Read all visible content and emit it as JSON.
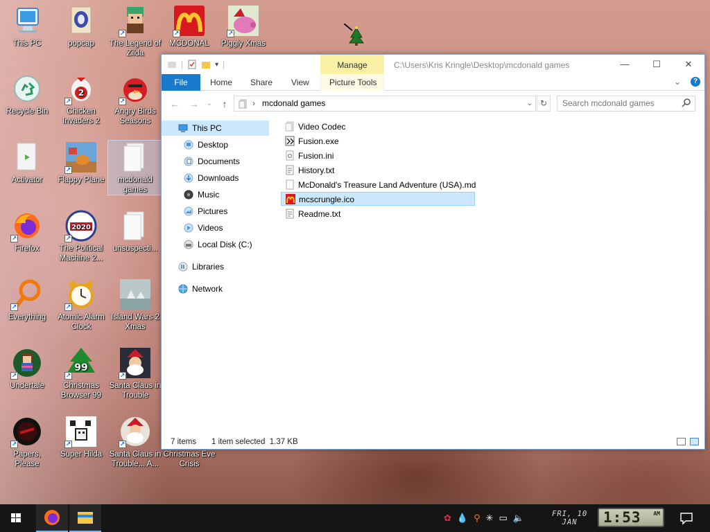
{
  "desktop": {
    "icons": [
      {
        "label": "This PC"
      },
      {
        "label": "popcap"
      },
      {
        "label": "The Legend of Zilda"
      },
      {
        "label": "MCDONAL"
      },
      {
        "label": "Piggly Xmas"
      },
      {
        "label": "Recycle Bin"
      },
      {
        "label": "Chicken Invaders 2"
      },
      {
        "label": "Angry Birds Seasons"
      },
      {
        "label": "Activator"
      },
      {
        "label": "Flappy Plane"
      },
      {
        "label": "mcdonald games"
      },
      {
        "label": "Firefox"
      },
      {
        "label": "The Political Machine 2..."
      },
      {
        "label": "unsuspecti..."
      },
      {
        "label": "Everything"
      },
      {
        "label": "Atomic Alarm Clock"
      },
      {
        "label": "Island Wars 2 Xmas"
      },
      {
        "label": "Undertale"
      },
      {
        "label": "Christmas Browser 99"
      },
      {
        "label": "Santa Claus in Trouble"
      },
      {
        "label": "Papers, Please"
      },
      {
        "label": "Super Hilda"
      },
      {
        "label": "Santa Claus in Trouble... A..."
      },
      {
        "label": "Christmas Eve Crisis"
      }
    ]
  },
  "explorer": {
    "title_path": "C:\\Users\\Kris Kringle\\Desktop\\mcdonald games",
    "contextual_tab_group": "Manage",
    "ribbon_tabs": [
      "File",
      "Home",
      "Share",
      "View",
      "Picture Tools"
    ],
    "address": "mcdonald games",
    "search_placeholder": "Search mcdonald games",
    "nav": [
      {
        "label": "This PC"
      },
      {
        "label": "Desktop"
      },
      {
        "label": "Documents"
      },
      {
        "label": "Downloads"
      },
      {
        "label": "Music"
      },
      {
        "label": "Pictures"
      },
      {
        "label": "Videos"
      },
      {
        "label": "Local Disk (C:)"
      },
      {
        "label": "Libraries"
      },
      {
        "label": "Network"
      }
    ],
    "files": [
      {
        "name": "Video Codec",
        "icon": "folder-icon"
      },
      {
        "name": "Fusion.exe",
        "icon": "exe-icon"
      },
      {
        "name": "Fusion.ini",
        "icon": "settings-file-icon"
      },
      {
        "name": "History.txt",
        "icon": "text-file-icon"
      },
      {
        "name": "McDonald's Treasure Land Adventure (USA).md",
        "icon": "file-icon"
      },
      {
        "name": "mcscrungle.ico",
        "icon": "mcdonalds-logo-icon",
        "selected": true
      },
      {
        "name": "Readme.txt",
        "icon": "text-file-icon"
      }
    ],
    "status": {
      "item_count": "7 items",
      "selection": "1 item selected  1.37 KB"
    }
  },
  "taskbar": {
    "date_line1": "FRI, 10",
    "date_line2": "JAN",
    "time": "1:53",
    "time_suffix": "AM"
  },
  "colors": {
    "accent": "#1979ca",
    "selection": "#cce8ff",
    "manage_tab": "#fbf1a6",
    "taskbar": "#151515"
  }
}
